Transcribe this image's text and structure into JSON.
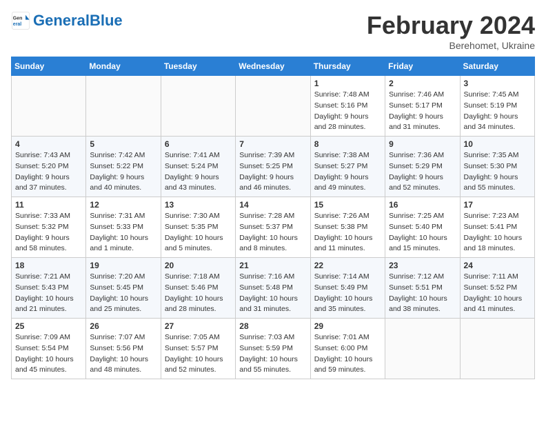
{
  "header": {
    "logo_general": "General",
    "logo_blue": "Blue",
    "month_year": "February 2024",
    "location": "Berehomet, Ukraine"
  },
  "weekdays": [
    "Sunday",
    "Monday",
    "Tuesday",
    "Wednesday",
    "Thursday",
    "Friday",
    "Saturday"
  ],
  "weeks": [
    [
      {
        "day": "",
        "info": ""
      },
      {
        "day": "",
        "info": ""
      },
      {
        "day": "",
        "info": ""
      },
      {
        "day": "",
        "info": ""
      },
      {
        "day": "1",
        "info": "Sunrise: 7:48 AM\nSunset: 5:16 PM\nDaylight: 9 hours\nand 28 minutes."
      },
      {
        "day": "2",
        "info": "Sunrise: 7:46 AM\nSunset: 5:17 PM\nDaylight: 9 hours\nand 31 minutes."
      },
      {
        "day": "3",
        "info": "Sunrise: 7:45 AM\nSunset: 5:19 PM\nDaylight: 9 hours\nand 34 minutes."
      }
    ],
    [
      {
        "day": "4",
        "info": "Sunrise: 7:43 AM\nSunset: 5:20 PM\nDaylight: 9 hours\nand 37 minutes."
      },
      {
        "day": "5",
        "info": "Sunrise: 7:42 AM\nSunset: 5:22 PM\nDaylight: 9 hours\nand 40 minutes."
      },
      {
        "day": "6",
        "info": "Sunrise: 7:41 AM\nSunset: 5:24 PM\nDaylight: 9 hours\nand 43 minutes."
      },
      {
        "day": "7",
        "info": "Sunrise: 7:39 AM\nSunset: 5:25 PM\nDaylight: 9 hours\nand 46 minutes."
      },
      {
        "day": "8",
        "info": "Sunrise: 7:38 AM\nSunset: 5:27 PM\nDaylight: 9 hours\nand 49 minutes."
      },
      {
        "day": "9",
        "info": "Sunrise: 7:36 AM\nSunset: 5:29 PM\nDaylight: 9 hours\nand 52 minutes."
      },
      {
        "day": "10",
        "info": "Sunrise: 7:35 AM\nSunset: 5:30 PM\nDaylight: 9 hours\nand 55 minutes."
      }
    ],
    [
      {
        "day": "11",
        "info": "Sunrise: 7:33 AM\nSunset: 5:32 PM\nDaylight: 9 hours\nand 58 minutes."
      },
      {
        "day": "12",
        "info": "Sunrise: 7:31 AM\nSunset: 5:33 PM\nDaylight: 10 hours\nand 1 minute."
      },
      {
        "day": "13",
        "info": "Sunrise: 7:30 AM\nSunset: 5:35 PM\nDaylight: 10 hours\nand 5 minutes."
      },
      {
        "day": "14",
        "info": "Sunrise: 7:28 AM\nSunset: 5:37 PM\nDaylight: 10 hours\nand 8 minutes."
      },
      {
        "day": "15",
        "info": "Sunrise: 7:26 AM\nSunset: 5:38 PM\nDaylight: 10 hours\nand 11 minutes."
      },
      {
        "day": "16",
        "info": "Sunrise: 7:25 AM\nSunset: 5:40 PM\nDaylight: 10 hours\nand 15 minutes."
      },
      {
        "day": "17",
        "info": "Sunrise: 7:23 AM\nSunset: 5:41 PM\nDaylight: 10 hours\nand 18 minutes."
      }
    ],
    [
      {
        "day": "18",
        "info": "Sunrise: 7:21 AM\nSunset: 5:43 PM\nDaylight: 10 hours\nand 21 minutes."
      },
      {
        "day": "19",
        "info": "Sunrise: 7:20 AM\nSunset: 5:45 PM\nDaylight: 10 hours\nand 25 minutes."
      },
      {
        "day": "20",
        "info": "Sunrise: 7:18 AM\nSunset: 5:46 PM\nDaylight: 10 hours\nand 28 minutes."
      },
      {
        "day": "21",
        "info": "Sunrise: 7:16 AM\nSunset: 5:48 PM\nDaylight: 10 hours\nand 31 minutes."
      },
      {
        "day": "22",
        "info": "Sunrise: 7:14 AM\nSunset: 5:49 PM\nDaylight: 10 hours\nand 35 minutes."
      },
      {
        "day": "23",
        "info": "Sunrise: 7:12 AM\nSunset: 5:51 PM\nDaylight: 10 hours\nand 38 minutes."
      },
      {
        "day": "24",
        "info": "Sunrise: 7:11 AM\nSunset: 5:52 PM\nDaylight: 10 hours\nand 41 minutes."
      }
    ],
    [
      {
        "day": "25",
        "info": "Sunrise: 7:09 AM\nSunset: 5:54 PM\nDaylight: 10 hours\nand 45 minutes."
      },
      {
        "day": "26",
        "info": "Sunrise: 7:07 AM\nSunset: 5:56 PM\nDaylight: 10 hours\nand 48 minutes."
      },
      {
        "day": "27",
        "info": "Sunrise: 7:05 AM\nSunset: 5:57 PM\nDaylight: 10 hours\nand 52 minutes."
      },
      {
        "day": "28",
        "info": "Sunrise: 7:03 AM\nSunset: 5:59 PM\nDaylight: 10 hours\nand 55 minutes."
      },
      {
        "day": "29",
        "info": "Sunrise: 7:01 AM\nSunset: 6:00 PM\nDaylight: 10 hours\nand 59 minutes."
      },
      {
        "day": "",
        "info": ""
      },
      {
        "day": "",
        "info": ""
      }
    ]
  ]
}
